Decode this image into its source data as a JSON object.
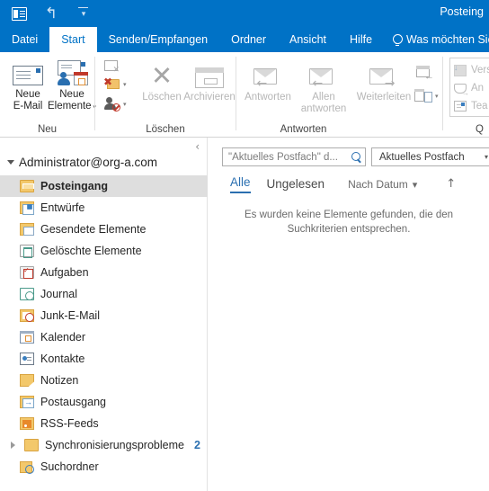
{
  "window": {
    "title": "Posteing",
    "quick_access": [
      {
        "name": "outlook-icon",
        "label": "Outlook"
      },
      {
        "name": "undo-icon",
        "label": "Rückgängig"
      },
      {
        "name": "customize-qat-icon",
        "label": "Symbolleiste für den Schnellzugriff anpassen"
      }
    ]
  },
  "tabs": [
    {
      "label": "Datei",
      "active": false
    },
    {
      "label": "Start",
      "active": true
    },
    {
      "label": "Senden/Empfangen",
      "active": false
    },
    {
      "label": "Ordner",
      "active": false
    },
    {
      "label": "Ansicht",
      "active": false
    },
    {
      "label": "Hilfe",
      "active": false
    }
  ],
  "tellme": {
    "label": "Was möchten Sie"
  },
  "ribbon": {
    "groups": [
      {
        "label": "Neu",
        "buttons": [
          {
            "label_line1": "Neue",
            "label_line2": "E-Mail",
            "disabled": false
          },
          {
            "label_line1": "Neue",
            "label_line2": "Elemente",
            "disabled": false,
            "dropdown": true
          }
        ]
      },
      {
        "label": "Löschen",
        "small_buttons": [
          {
            "label": "Ignorieren"
          },
          {
            "label": "Junk-E-Mail"
          },
          {
            "label": "Absender blockieren"
          }
        ],
        "buttons": [
          {
            "label_line1": "Löschen",
            "disabled": true
          },
          {
            "label_line1": "Archivieren",
            "disabled": true
          }
        ]
      },
      {
        "label": "Antworten",
        "buttons": [
          {
            "label_line1": "Antworten",
            "disabled": true
          },
          {
            "label_line1": "Allen",
            "label_line2": "antworten",
            "disabled": true
          },
          {
            "label_line1": "Weiterleiten",
            "disabled": true
          }
        ],
        "small_buttons": [
          {
            "label": "Verschieben"
          },
          {
            "label": "Regeln"
          }
        ]
      },
      {
        "label": "Q",
        "quick_steps": [
          {
            "label": "Vers"
          },
          {
            "label": "An "
          },
          {
            "label": "Tea"
          }
        ]
      }
    ]
  },
  "sidebar": {
    "collapse_label": "‹",
    "account": "Administrator@org-a.com",
    "folders": [
      {
        "label": "Posteingang",
        "icon": "inbox-folder-icon",
        "selected": true
      },
      {
        "label": "Entwürfe",
        "icon": "drafts-folder-icon",
        "selected": false
      },
      {
        "label": "Gesendete Elemente",
        "icon": "sent-folder-icon",
        "selected": false
      },
      {
        "label": "Gelöschte Elemente",
        "icon": "deleted-folder-icon",
        "selected": false
      },
      {
        "label": "Aufgaben",
        "icon": "tasks-folder-icon",
        "selected": false
      },
      {
        "label": "Journal",
        "icon": "journal-folder-icon",
        "selected": false
      },
      {
        "label": "Junk-E-Mail",
        "icon": "junk-folder-icon",
        "selected": false
      },
      {
        "label": "Kalender",
        "icon": "calendar-folder-icon",
        "selected": false
      },
      {
        "label": "Kontakte",
        "icon": "contacts-folder-icon",
        "selected": false
      },
      {
        "label": "Notizen",
        "icon": "notes-folder-icon",
        "selected": false
      },
      {
        "label": "Postausgang",
        "icon": "outbox-folder-icon",
        "selected": false
      },
      {
        "label": "RSS-Feeds",
        "icon": "rss-folder-icon",
        "selected": false
      },
      {
        "label": "Synchronisierungsprobleme",
        "icon": "sync-issues-folder-icon",
        "selected": false,
        "badge": "2",
        "expandable": true
      },
      {
        "label": "Suchordner",
        "icon": "search-folder-icon",
        "selected": false
      }
    ]
  },
  "message_list": {
    "search": {
      "placeholder": "\"Aktuelles Postfach\" d...",
      "value": ""
    },
    "scope": {
      "selected": "Aktuelles Postfach"
    },
    "filters": [
      {
        "label": "Alle",
        "active": true
      },
      {
        "label": "Ungelesen",
        "active": false
      }
    ],
    "sort": {
      "label": "Nach Datum",
      "direction": "↑"
    },
    "empty_text": "Es wurden keine Elemente gefunden, die den Suchkriterien entsprechen."
  },
  "colors": {
    "accent": "#0072c6",
    "selected_row": "#dedede",
    "badge": "#2a6fb0"
  }
}
